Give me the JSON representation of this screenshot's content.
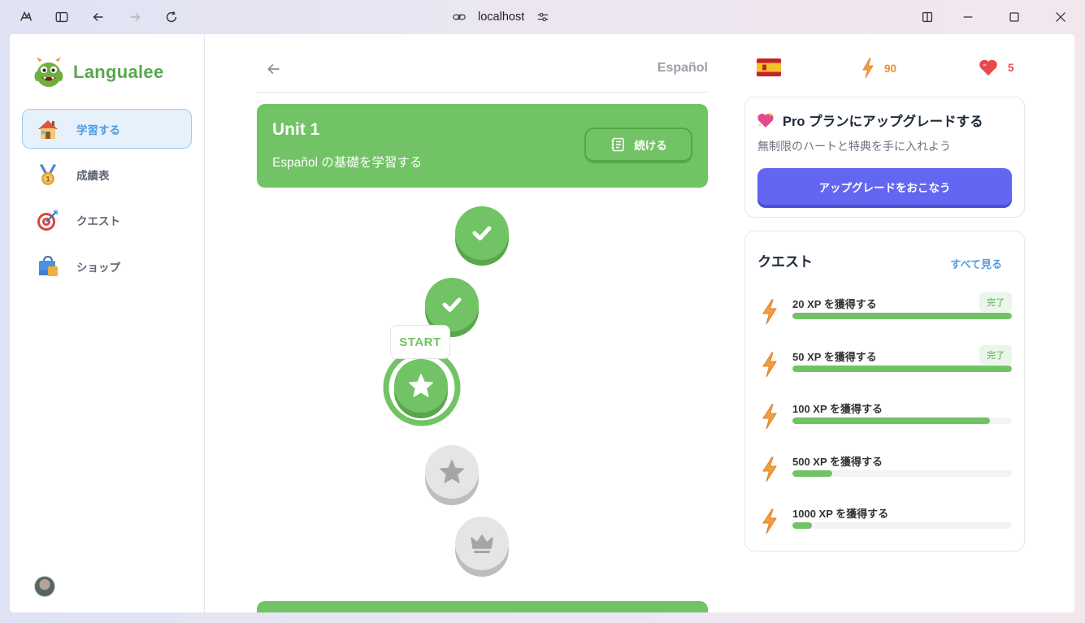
{
  "browser": {
    "url": "localhost",
    "icons": {
      "app": "app-logo-icon",
      "sidebar_toggle": "sidebar-toggle-icon",
      "back": "arrow-left-icon",
      "forward": "arrow-right-icon",
      "reload": "reload-icon",
      "link": "link-icon",
      "site_settings": "sliders-icon",
      "split": "split-view-icon",
      "minimize": "minimize-icon",
      "maximize": "maximize-icon",
      "close": "close-icon"
    }
  },
  "sidebar": {
    "app_name": "Langualee",
    "logo_icon": "green-monster-icon",
    "items": [
      {
        "label": "学習する",
        "icon": "house-icon",
        "active": true
      },
      {
        "label": "成績表",
        "icon": "medal-icon",
        "active": false
      },
      {
        "label": "クエスト",
        "icon": "target-icon",
        "active": false
      },
      {
        "label": "ショップ",
        "icon": "shopping-bag-icon",
        "active": false
      }
    ]
  },
  "main": {
    "language": "Español",
    "unit": {
      "title": "Unit 1",
      "description": "Español の基礎を学習する",
      "continue_label": "続ける"
    },
    "path": {
      "start_label": "START",
      "nodes": [
        {
          "state": "completed",
          "icon": "check-icon"
        },
        {
          "state": "completed",
          "icon": "check-icon"
        },
        {
          "state": "current",
          "icon": "star-icon"
        },
        {
          "state": "locked",
          "icon": "star-icon"
        },
        {
          "state": "locked",
          "icon": "crown-icon"
        }
      ]
    }
  },
  "stats": {
    "flag_icon": "spain-flag-icon",
    "xp": "90",
    "hearts": "5",
    "xp_color": "#e9922b",
    "hearts_color": "#e5534b"
  },
  "pro": {
    "title": "Pro プランにアップグレードする",
    "subtitle": "無制限のハートと特典を手に入れよう",
    "button": "アップグレードをおこなう"
  },
  "quests": {
    "title": "クエスト",
    "see_all": "すべて見る",
    "items": [
      {
        "label": "20 XP を獲得する",
        "progress": 1.0,
        "badge": "完了"
      },
      {
        "label": "50 XP を獲得する",
        "progress": 1.0,
        "badge": "完了"
      },
      {
        "label": "100 XP を獲得する",
        "progress": 0.9,
        "badge": ""
      },
      {
        "label": "500 XP を獲得する",
        "progress": 0.18,
        "badge": ""
      },
      {
        "label": "1000 XP を獲得する",
        "progress": 0.09,
        "badge": ""
      }
    ]
  },
  "colors": {
    "primary_green": "#72c365",
    "accent_blue": "#4e9ce6",
    "upgrade_purple": "#6366f1"
  }
}
